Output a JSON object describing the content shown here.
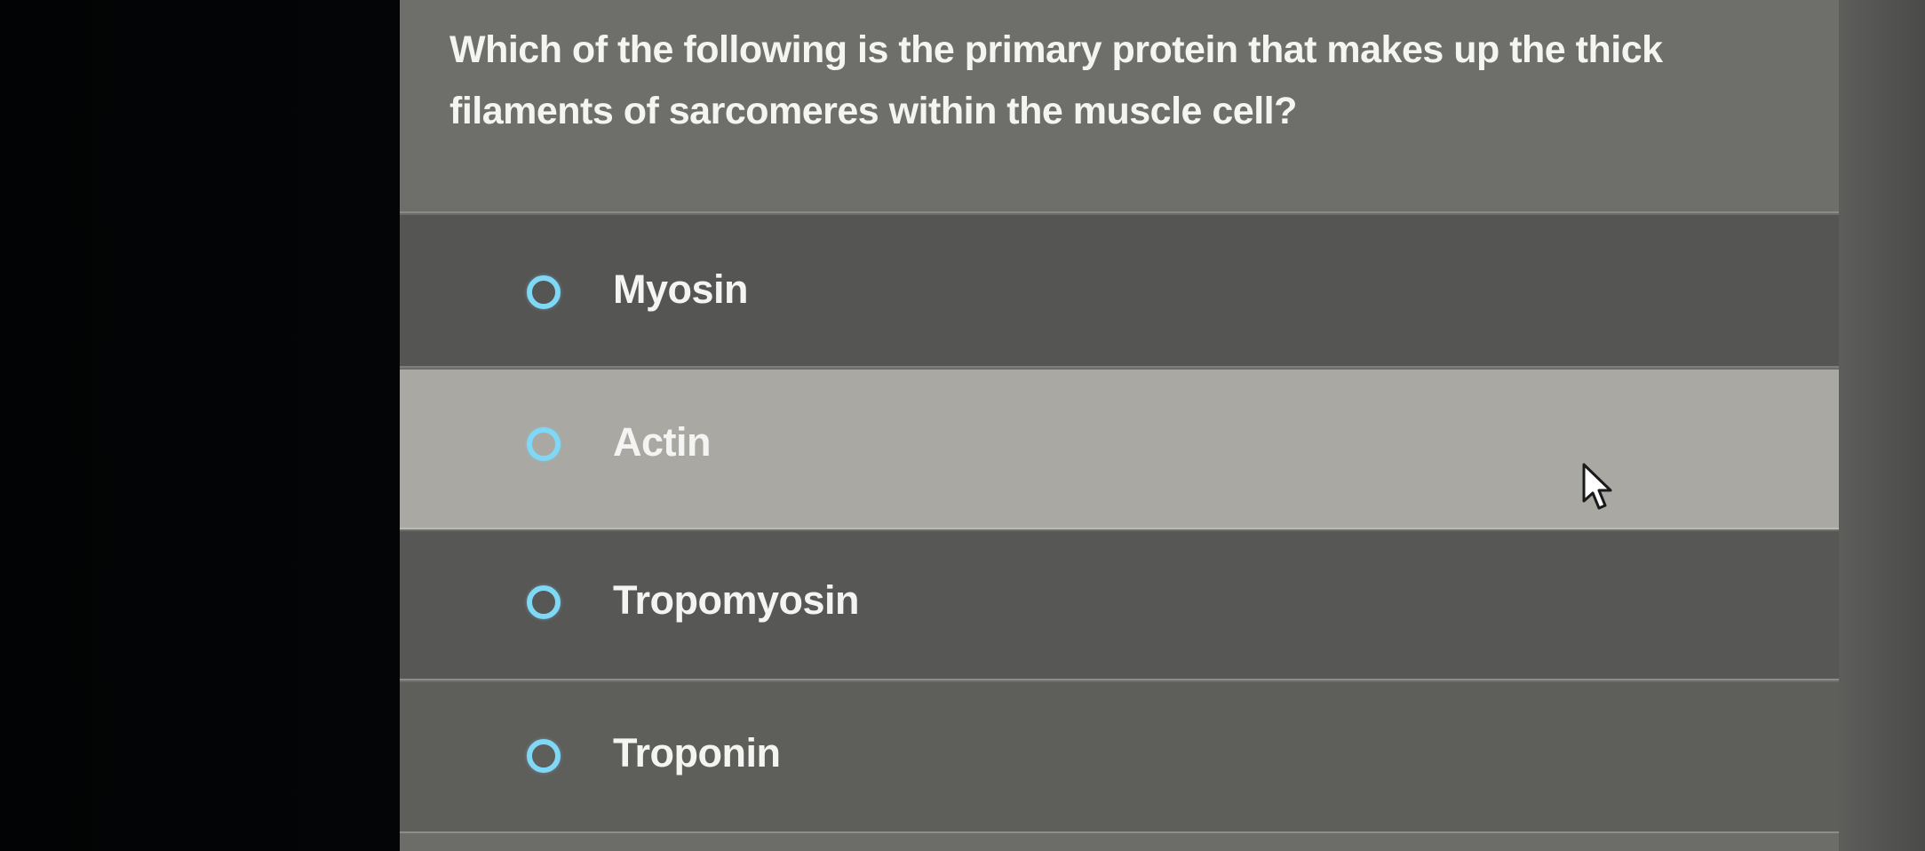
{
  "question": {
    "text": "Which of the following is the primary protein that makes up the thick filaments of sarcomeres within the muscle cell?"
  },
  "options": [
    {
      "label": "Myosin",
      "selected": false
    },
    {
      "label": "Actin",
      "selected": false
    },
    {
      "label": "Tropomyosin",
      "selected": false
    },
    {
      "label": "Troponin",
      "selected": false
    }
  ],
  "colors": {
    "radio_ring": "#7fd8f6",
    "hovered_row": "#a9a8a2",
    "row": "#555553",
    "text": "#f4f4f2"
  },
  "icons": {
    "radio": "radio-unchecked-icon",
    "cursor": "mouse-pointer-icon"
  }
}
